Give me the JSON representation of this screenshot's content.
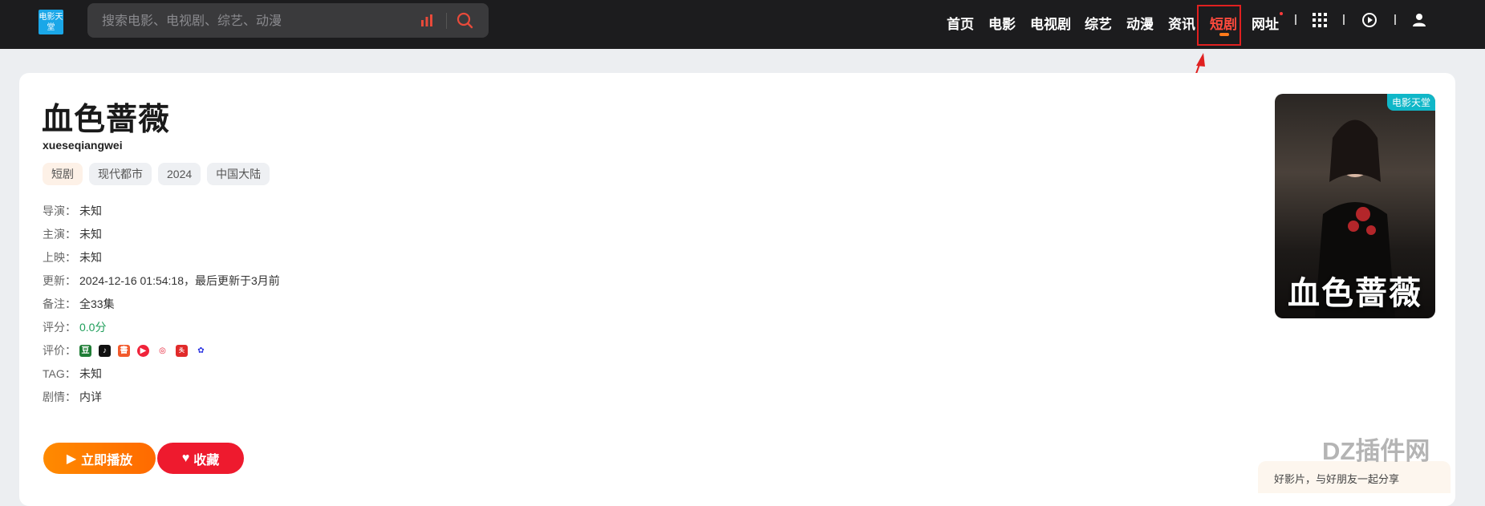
{
  "header": {
    "logo_text": "电影天堂",
    "search_placeholder": "搜索电影、电视剧、综艺、动漫",
    "nav": [
      "首页",
      "电影",
      "电视剧",
      "综艺",
      "动漫",
      "资讯",
      "短剧",
      "网址"
    ],
    "active_nav": "短剧"
  },
  "detail": {
    "title": "血色蔷薇",
    "subtitle": "xueseqiangwei",
    "tags": [
      "短剧",
      "现代都市",
      "2024",
      "中国大陆"
    ],
    "info": [
      {
        "k": "导演：",
        "v": "未知"
      },
      {
        "k": "主演：",
        "v": "未知"
      },
      {
        "k": "上映：",
        "v": "未知"
      },
      {
        "k": "更新：",
        "v": "2024-12-16 01:54:18，最后更新于3月前"
      },
      {
        "k": "备注：",
        "v": "全33集"
      },
      {
        "k": "评分：",
        "v": "0.0分"
      },
      {
        "k": "评价：",
        "v": ""
      },
      {
        "k": "TAG：",
        "v": "未知"
      },
      {
        "k": "剧情：",
        "v": "内详"
      }
    ],
    "play_label": "立即播放",
    "fav_label": "收藏"
  },
  "poster": {
    "badge": "电影天堂",
    "title_art": "血色蔷薇"
  },
  "share_text": "好影片，与好朋友一起分享",
  "watermark": "DZ插件网",
  "colors": {
    "accent": "#ff4a3d",
    "play": "#ff7a00",
    "fav": "#ee1a2e",
    "topbar": "#1c1c1e"
  }
}
